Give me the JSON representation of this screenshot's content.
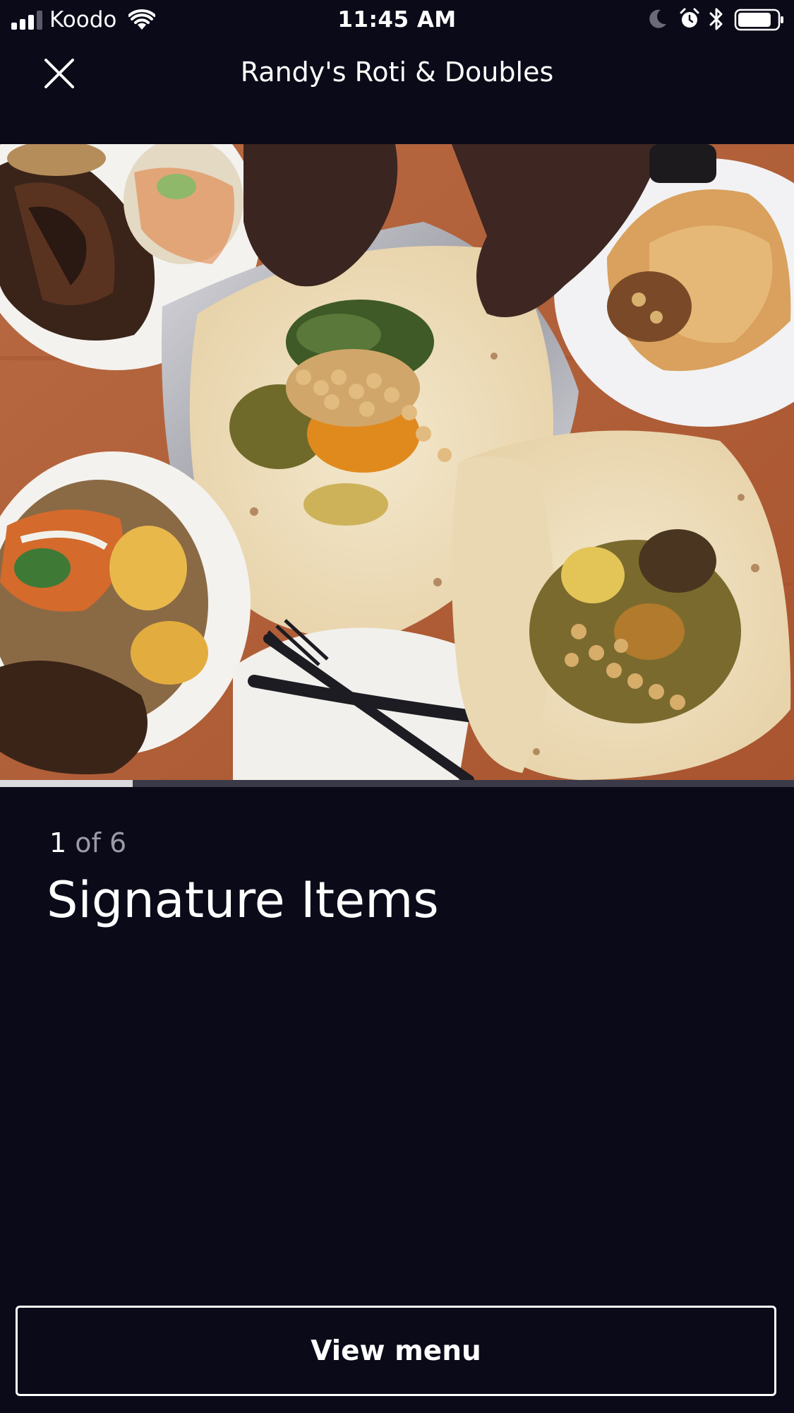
{
  "status_bar": {
    "carrier": "Koodo",
    "time": "11:45 AM",
    "signal_bars": 3,
    "signal_bars_total": 4,
    "battery_level": 0.85,
    "icons": [
      "signal-icon",
      "wifi-icon",
      "moon-icon",
      "alarm-icon",
      "bluetooth-icon",
      "battery-icon"
    ]
  },
  "header": {
    "title": "Randy's Roti & Doubles",
    "close_icon": "close-icon"
  },
  "gallery": {
    "current": "1",
    "of_label": "of 6",
    "total": 6,
    "progress_fraction": 0.1667,
    "caption": "Signature Items"
  },
  "actions": {
    "view_menu_label": "View menu"
  },
  "colors": {
    "background": "#0a0a19",
    "text": "#ffffff",
    "muted_text": "#9b9ba6",
    "progress_fill": "#d9d9de",
    "progress_track": "#3a3a48"
  }
}
